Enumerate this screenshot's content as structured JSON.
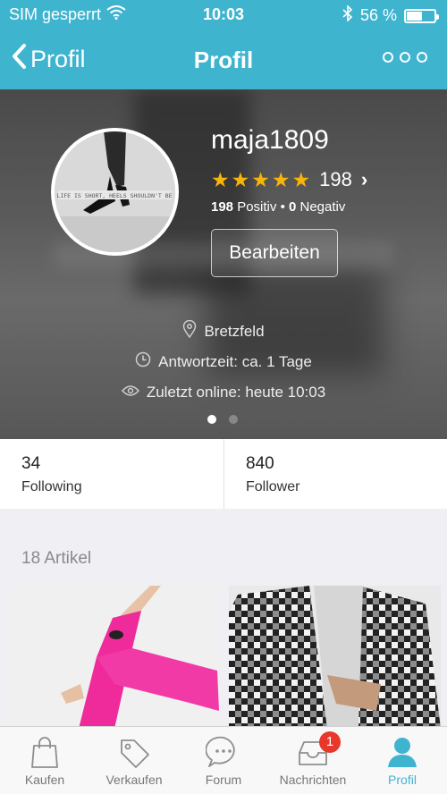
{
  "status_bar": {
    "carrier": "SIM gesperrt",
    "time": "10:03",
    "battery_text": "56 %",
    "battery_level": 0.56
  },
  "navbar": {
    "back_label": "Profil",
    "title": "Profil"
  },
  "profile": {
    "avatar_caption": "LIFE IS SHORT, HEELS SHOULDN'T BE",
    "username": "maja1809",
    "rating_stars": 5,
    "rating_count": "198",
    "positive_count": "198",
    "positive_label": "Positiv",
    "negative_count": "0",
    "negative_label": "Negativ",
    "edit_label": "Bearbeiten",
    "location": "Bretzfeld",
    "response_time": "Antwortzeit: ca. 1 Tage",
    "last_online": "Zuletzt online: heute 10:03"
  },
  "carousel": {
    "pages": 2,
    "active": 0
  },
  "stats": {
    "following_count": "34",
    "following_label": "Following",
    "follower_count": "840",
    "follower_label": "Follower"
  },
  "items_section": {
    "title": "18 Artikel"
  },
  "tabbar": {
    "tabs": [
      {
        "label": "Kaufen",
        "icon": "shopping-bag-icon"
      },
      {
        "label": "Verkaufen",
        "icon": "price-tag-icon"
      },
      {
        "label": "Forum",
        "icon": "chat-bubble-icon"
      },
      {
        "label": "Nachrichten",
        "icon": "inbox-icon",
        "badge": "1"
      },
      {
        "label": "Profil",
        "icon": "person-icon"
      }
    ],
    "active_index": 4
  },
  "colors": {
    "accent": "#3fb4cf",
    "star": "#f7b50b",
    "badge": "#e8382b"
  }
}
